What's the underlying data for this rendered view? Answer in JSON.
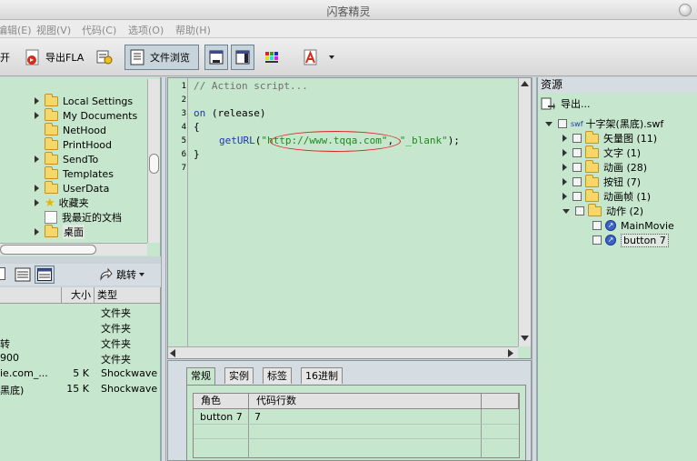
{
  "app": {
    "title": "闪客精灵"
  },
  "menu": [
    "编辑(E)",
    "视图(V)",
    "代码(C)",
    "选项(O)",
    "帮助(H)"
  ],
  "toolbar": {
    "open_label": "开",
    "export_fla_label": "导出FLA",
    "file_browse_label": "文件浏览"
  },
  "left_tree": {
    "items": [
      {
        "label": "Local Settings",
        "expand": true
      },
      {
        "label": "My Documents",
        "expand": true
      },
      {
        "label": "NetHood",
        "expand": false
      },
      {
        "label": "PrintHood",
        "expand": false
      },
      {
        "label": "SendTo",
        "expand": true
      },
      {
        "label": "Templates",
        "expand": false
      },
      {
        "label": "UserData",
        "expand": true
      },
      {
        "label": "收藏夹",
        "expand": true
      },
      {
        "label": "我最近的文档",
        "expand": false
      },
      {
        "label": "桌面",
        "expand": true
      }
    ]
  },
  "file_list": {
    "jump_label": "跳转",
    "headers": {
      "size": "大小",
      "type": "类型"
    },
    "rows": [
      {
        "name": "",
        "size": "",
        "type": "文件夹"
      },
      {
        "name": "",
        "size": "",
        "type": "文件夹"
      },
      {
        "name": "转",
        "size": "",
        "type": "文件夹"
      },
      {
        "name": "900",
        "size": "",
        "type": "文件夹"
      },
      {
        "name": "ie.com_...",
        "size": "5 K",
        "type": "Shockwave Fl"
      },
      {
        "name": "黑底)",
        "size": "15 K",
        "type": "Shockwave Fl"
      }
    ]
  },
  "editor": {
    "line_numbers": [
      "1",
      "2",
      "3",
      "4",
      "5",
      "6",
      "7"
    ],
    "comment": "// Action script...",
    "on_kw": "on",
    "on_arg": " (release)",
    "open_brace": "{",
    "geturl_fn": "getURL",
    "paren_open": "(",
    "url": "\"http://www.tqqa.com\"",
    "comma": ", ",
    "target": "\"_blank\"",
    "paren_close": ");",
    "close_brace": "}"
  },
  "props": {
    "tabs": [
      "常规",
      "实例",
      "标签",
      "16进制"
    ],
    "headers": {
      "role": "角色",
      "lines": "代码行数"
    },
    "rows": [
      {
        "role": "button 7",
        "lines": "7"
      }
    ]
  },
  "resources": {
    "header": "资源",
    "export_label": "导出...",
    "root_badge": "swf",
    "root_label": "十字架(黑底).swf",
    "nodes": [
      {
        "label": "矢量图 (11)"
      },
      {
        "label": "文字 (1)"
      },
      {
        "label": "动画 (28)"
      },
      {
        "label": "按钮 (7)"
      },
      {
        "label": "动画帧 (1)"
      },
      {
        "label": "动作 (2)"
      }
    ],
    "children": [
      {
        "label": "MainMovie"
      },
      {
        "label": "button 7"
      }
    ]
  }
}
